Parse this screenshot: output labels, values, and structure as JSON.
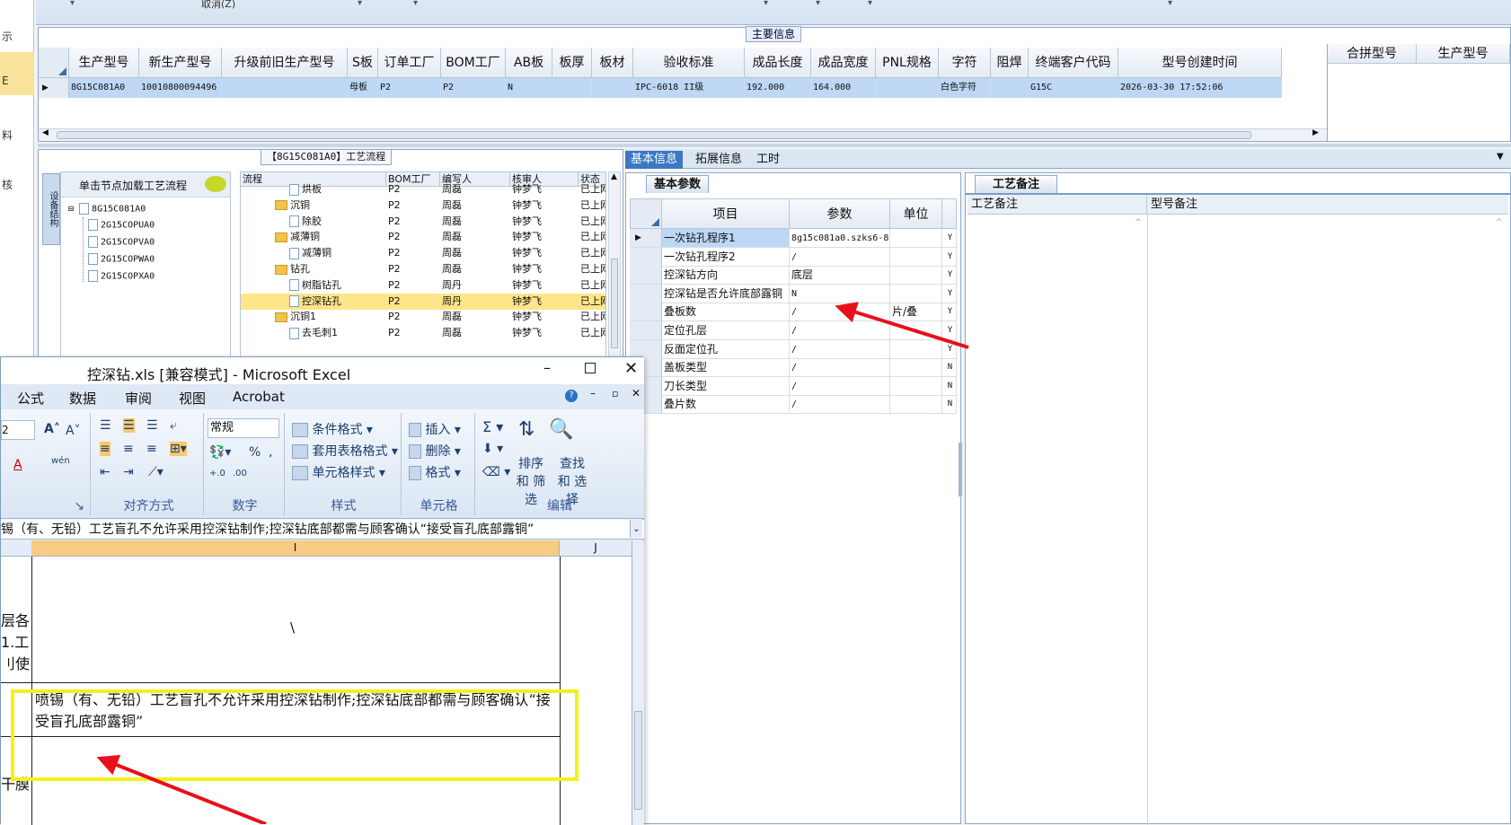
{
  "leftnav": {
    "items": [
      "示",
      "E",
      "料",
      "核"
    ]
  },
  "topstrip": {
    "cancel": "取消(Z)"
  },
  "main_info": {
    "title": "主要信息",
    "headers": [
      "生产型号",
      "新生产型号",
      "升级前旧生产型号",
      "S板",
      "订单工厂",
      "BOM工厂",
      "AB板",
      "板厚",
      "板材",
      "验收标准",
      "成品长度",
      "成品宽度",
      "PNL规格",
      "字符",
      "阻焊",
      "终端客户代码",
      "型号创建时间"
    ],
    "right_headers": [
      "合拼型号",
      "生产型号"
    ],
    "row": [
      "8G15C081A0",
      "10010800094496",
      "",
      "母板",
      "P2",
      "P2",
      "N",
      "",
      "",
      "IPC-6018 II级",
      "192.000",
      "164.000",
      "",
      "白色字符",
      "",
      "G15C",
      "2026-03-30 17:52:06"
    ]
  },
  "proc": {
    "title": "【8G15C081A0】工艺流程",
    "side_tab": "设备结构",
    "load_label": "单击节点加载工艺流程",
    "tree_root": "8G15C081A0",
    "tree_children": [
      "2G15COPUA0",
      "2G15COPVA0",
      "2G15COPWA0",
      "2G15COPXA0"
    ],
    "grid_headers": [
      "流程",
      "BOM工厂",
      "编写人",
      "核审人",
      "状态"
    ],
    "rows": [
      {
        "name": "烘板",
        "factory": "P2",
        "writer": "周磊",
        "reviewer": "钟梦飞",
        "status": "已上网",
        "type": "doc",
        "indent": 2
      },
      {
        "name": "沉铜",
        "factory": "P2",
        "writer": "周磊",
        "reviewer": "钟梦飞",
        "status": "已上网",
        "type": "folder",
        "indent": 1
      },
      {
        "name": "除胶",
        "factory": "P2",
        "writer": "周磊",
        "reviewer": "钟梦飞",
        "status": "已上网",
        "type": "doc",
        "indent": 2
      },
      {
        "name": "减薄铜",
        "factory": "P2",
        "writer": "周磊",
        "reviewer": "钟梦飞",
        "status": "已上网",
        "type": "folder",
        "indent": 1
      },
      {
        "name": "减薄铜",
        "factory": "P2",
        "writer": "周磊",
        "reviewer": "钟梦飞",
        "status": "已上网",
        "type": "doc",
        "indent": 2
      },
      {
        "name": "钻孔",
        "factory": "P2",
        "writer": "周磊",
        "reviewer": "钟梦飞",
        "status": "已上网",
        "type": "folder",
        "indent": 1
      },
      {
        "name": "树脂钻孔",
        "factory": "P2",
        "writer": "周丹",
        "reviewer": "钟梦飞",
        "status": "已上网",
        "type": "doc",
        "indent": 2
      },
      {
        "name": "控深钻孔",
        "factory": "P2",
        "writer": "周丹",
        "reviewer": "钟梦飞",
        "status": "已上网",
        "type": "doc",
        "indent": 2,
        "selected": true
      },
      {
        "name": "沉铜1",
        "factory": "P2",
        "writer": "周磊",
        "reviewer": "钟梦飞",
        "status": "已上网",
        "type": "folder",
        "indent": 1
      },
      {
        "name": "去毛刺1",
        "factory": "P2",
        "writer": "周磊",
        "reviewer": "钟梦飞",
        "status": "已上网",
        "type": "doc",
        "indent": 2
      }
    ]
  },
  "tabs": [
    "基本信息",
    "拓展信息",
    "工时"
  ],
  "params": {
    "subtab": "基本参数",
    "headers": [
      "项目",
      "参数",
      "单位"
    ],
    "rows": [
      {
        "item": "一次钻孔程序1",
        "value": "8g15c081a0.szks6-8b",
        "unit": "",
        "flag": "Y"
      },
      {
        "item": "一次钻孔程序2",
        "value": "/",
        "unit": "",
        "flag": "Y"
      },
      {
        "item": "控深钻方向",
        "value": "底层",
        "unit": "",
        "flag": "Y"
      },
      {
        "item": "控深钻是否允许底部露铜",
        "value": "N",
        "unit": "",
        "flag": "Y"
      },
      {
        "item": "叠板数",
        "value": "/",
        "unit": "片/叠",
        "flag": "Y"
      },
      {
        "item": "定位孔层",
        "value": "/",
        "unit": "",
        "flag": "Y"
      },
      {
        "item": "反面定位孔",
        "value": "/",
        "unit": "",
        "flag": "Y"
      },
      {
        "item": "盖板类型",
        "value": "/",
        "unit": "",
        "flag": "N"
      },
      {
        "item": "刀长类型",
        "value": "/",
        "unit": "",
        "flag": "N"
      },
      {
        "item": "叠片数",
        "value": "/",
        "unit": "",
        "flag": "N"
      }
    ]
  },
  "notes": {
    "tab": "工艺备注",
    "col1": "工艺备注",
    "col2": "型号备注"
  },
  "excel": {
    "title": "控深钻.xls [兼容模式] - Microsoft Excel",
    "menu": [
      "公式",
      "数据",
      "审阅",
      "视图",
      "Acrobat"
    ],
    "font_size": "2",
    "number_format": "常规",
    "groups": {
      "align": "对齐方式",
      "number": "数字",
      "style": "样式",
      "cells": "单元格",
      "edit": "编辑"
    },
    "style_buttons": [
      "条件格式",
      "套用表格格式",
      "单元格样式"
    ],
    "cell_buttons": [
      "插入",
      "删除",
      "格式"
    ],
    "sort_label": "排序和 筛选",
    "find_label": "查找和 选择",
    "formula": "锡（有、无铅）工艺盲孔不允许采用控深钻制作;控深钻底部都需与顾客确认“接受盲孔底部露铜”",
    "col_i": "I",
    "col_j": "J",
    "cell_top": "\\",
    "left_frag": [
      "层各",
      "1.工",
      "刂使",
      "干膜"
    ],
    "cell_text": "喷锡（有、无铅）工艺盲孔不允许采用控深钻制作;控深钻底部都需与顾客确认“接受盲孔底部露铜”"
  }
}
